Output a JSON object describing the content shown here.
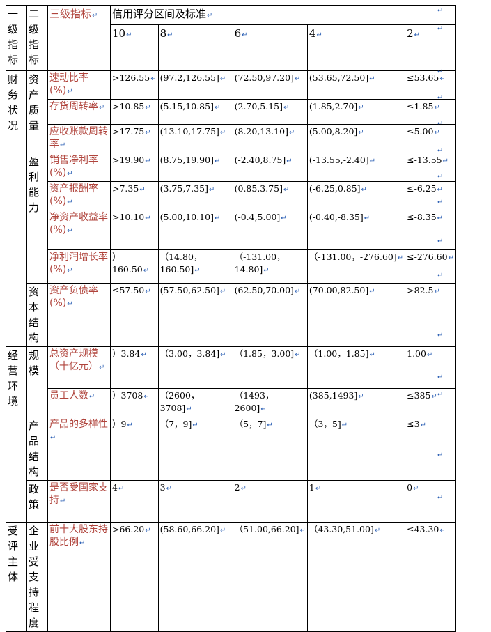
{
  "headers": {
    "level1": "一级指标",
    "level2": "二级指标",
    "level3": "三级指标",
    "credit_range": "信用评分区间及标准",
    "scores": [
      "10",
      "8",
      "6",
      "4",
      "2"
    ]
  },
  "groups": {
    "financial": "财务状况",
    "operating": "经营环境",
    "supported": "受评主体"
  },
  "subgroups": {
    "asset_quality": "资产质量",
    "profitability": "盈利能力",
    "capital_structure": "资本结构",
    "scale": "规模",
    "product_structure": "产品结构",
    "policy": "政策",
    "enterprise_support": "企业受支持程度"
  },
  "rows": [
    {
      "indicator": "速动比率(%)",
      "v10": ">126.55",
      "v8": "(97.2,126.55]",
      "v6": "(72.50,97.20]",
      "v4": "(53.65,72.50]",
      "v2": "≤53.65"
    },
    {
      "indicator": "存货周转率",
      "v10": ">10.85",
      "v8": "(5.15,10.85]",
      "v6": "(2.70,5.15]",
      "v4": "(1.85,2.70]",
      "v2": "≤1.85"
    },
    {
      "indicator": "应收账款周转率",
      "v10": ">17.75",
      "v8": "(13.10,17.75]",
      "v6": "(8.20,13.10]",
      "v4": "(5.00,8.20]",
      "v2": "≤5.00"
    },
    {
      "indicator": "销售净利率(%)",
      "v10": ">19.90",
      "v8": "(8.75,19.90]",
      "v6": "(-2.40,8.75]",
      "v4": "(-13.55,-2.40]",
      "v2": "≤-13.55"
    },
    {
      "indicator": "资产报酬率(%)",
      "v10": ">7.35",
      "v8": "(3.75,7.35]",
      "v6": "(0.85,3.75]",
      "v4": "(-6.25,0.85]",
      "v2": "≤-6.25"
    },
    {
      "indicator": "净资产收益率(%)",
      "v10": ">10.10",
      "v8": "(5.00,10.10]",
      "v6": "(-0.4,5.00]",
      "v4": "(-0.40,-8.35]",
      "v2": "≤-8.35"
    },
    {
      "indicator": "净利润增长率(%)",
      "v10": "）160.50",
      "v8": "（14.80，160.50]",
      "v6": "（-131.00，14.80]",
      "v4": "（-131.00，-276.60]",
      "v2": "≤-276.60"
    },
    {
      "indicator": "资产负债率(%)",
      "v10": "≤57.50",
      "v8": "(57.50,62.50]",
      "v6": "(62.50,70.00]",
      "v4": "(70.00,82.50]",
      "v2": ">82.5"
    },
    {
      "indicator": "总资产规模（十亿元）",
      "v10": "）3.84",
      "v8": "（3.00，3.84]",
      "v6": "（1.85，3.00]",
      "v4": "（1.00，1.85]",
      "v2": "1.00"
    },
    {
      "indicator": "员工人数",
      "v10": "）3708",
      "v8": "（2600，3708]",
      "v6": "（1493，2600]",
      "v4": "(385,1493]",
      "v2": "≤385"
    },
    {
      "indicator": "产品的多样性",
      "v10": "）9",
      "v8": "（7，9]",
      "v6": "（5，7]",
      "v4": "（3，5]",
      "v2": "≤3"
    },
    {
      "indicator": "是否受国家支持",
      "v10": "4",
      "v8": "3",
      "v6": "2",
      "v4": "1",
      "v2": "0"
    },
    {
      "indicator": "前十大股东持股比例",
      "v10": ">66.20",
      "v8": "(58.60,66.20]",
      "v6": "（51.00,66.20]",
      "v4": "（43.30,51.00]",
      "v2": "≤43.30"
    }
  ],
  "paragraph_mark": "↵"
}
